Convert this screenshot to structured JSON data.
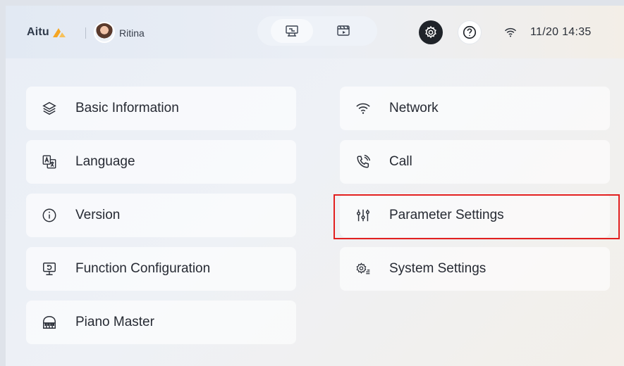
{
  "header": {
    "brand": "Aitu",
    "user_name": "Ritina",
    "datetime": "11/20 14:35",
    "mode_buttons": [
      {
        "icon": "machine-icon"
      },
      {
        "icon": "video-icon"
      }
    ],
    "settings_icon": "gear-icon",
    "help_icon": "help-icon",
    "wifi_icon": "wifi-icon"
  },
  "menu": {
    "left": [
      {
        "label": "Basic Information",
        "icon": "layers-icon"
      },
      {
        "label": "Language",
        "icon": "translate-icon"
      },
      {
        "label": "Version",
        "icon": "info-icon"
      },
      {
        "label": "Function Configuration",
        "icon": "monitor-icon"
      },
      {
        "label": "Piano Master",
        "icon": "piano-icon"
      }
    ],
    "right": [
      {
        "label": "Network",
        "icon": "wifi-icon"
      },
      {
        "label": "Call",
        "icon": "phone-icon"
      },
      {
        "label": "Parameter Settings",
        "icon": "sliders-icon",
        "highlighted": true
      },
      {
        "label": "System Settings",
        "icon": "system-gear-icon"
      }
    ]
  },
  "colors": {
    "accent_orange": "#f5a623",
    "highlight_red": "#e21f1f",
    "dark_button": "#1f2329"
  }
}
